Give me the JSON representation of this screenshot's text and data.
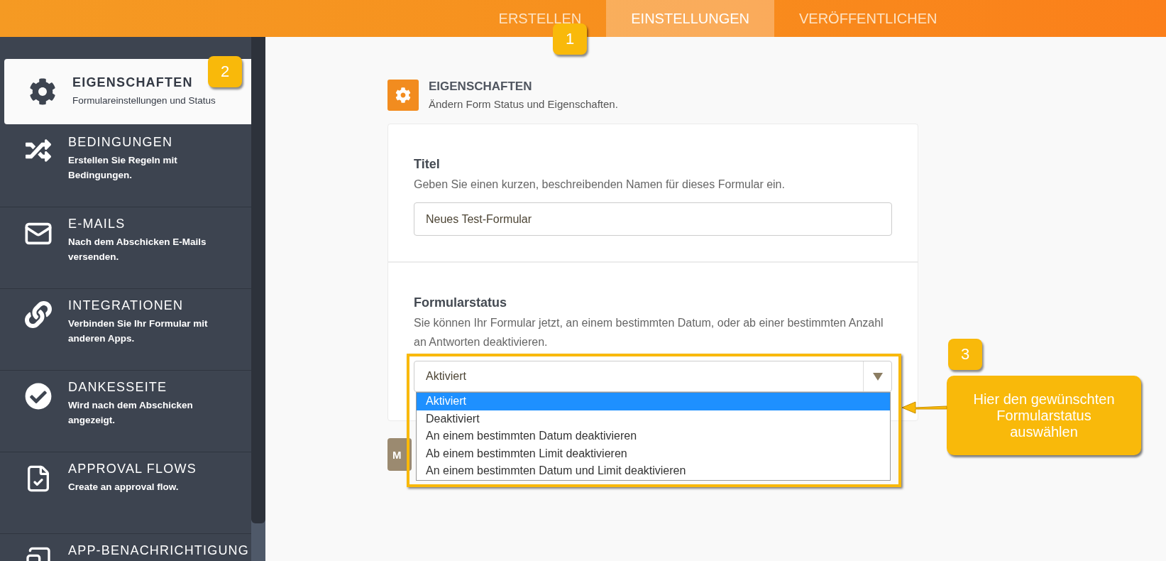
{
  "top_nav": {
    "tabs": [
      {
        "label": "ERSTELLEN",
        "selected": false
      },
      {
        "label": "EINSTELLUNGEN",
        "selected": true
      },
      {
        "label": "VERÖFFENTLICHEN",
        "selected": false
      }
    ],
    "step_badge": "1"
  },
  "sidebar": {
    "step_badge": "2",
    "items": [
      {
        "kind": "gear",
        "title": "EIGENSCHAFTEN",
        "subtitle": "Formulareinstellungen und Status",
        "selected": true
      },
      {
        "kind": "conditions",
        "title": "BEDINGUNGEN",
        "subtitle": "Erstellen Sie Regeln mit Bedingungen.",
        "selected": false
      },
      {
        "kind": "mail",
        "title": "E-MAILS",
        "subtitle": "Nach dem Abschicken E-Mails versenden.",
        "selected": false
      },
      {
        "kind": "link",
        "title": "INTEGRATIONEN",
        "subtitle": "Verbinden Sie Ihr Formular mit anderen Apps.",
        "selected": false
      },
      {
        "kind": "check",
        "title": "DANKESSEITE",
        "subtitle": "Wird nach dem Abschicken angezeigt.",
        "selected": false
      },
      {
        "kind": "approval",
        "title": "APPROVAL FLOWS",
        "subtitle": "Create an approval flow.",
        "selected": false
      },
      {
        "kind": "device",
        "title": "APP-BENACHRICHTIGUNG",
        "selected": false
      }
    ]
  },
  "panel": {
    "title": "EIGENSCHAFTEN",
    "subtitle": "Ändern Form Status und Eigenschaften.",
    "title_field": {
      "label": "Titel",
      "description": "Geben Sie einen kurzen, beschreibenden Namen für dieses Formular ein.",
      "value": "Neues Test-Formular"
    },
    "status_field": {
      "label": "Formularstatus",
      "description": "Sie können Ihr Formular jetzt, an einem bestimmten Datum, oder ab einer bestimmten Anzahl an Antworten deaktivieren.",
      "value": "Aktiviert",
      "options": [
        {
          "label": "Aktiviert",
          "selected": true
        },
        {
          "label": "Deaktiviert",
          "selected": false
        },
        {
          "label": "An einem bestimmten Datum deaktivieren",
          "selected": false
        },
        {
          "label": "Ab einem bestimmten Limit deaktivieren",
          "selected": false
        },
        {
          "label": "An einem bestimmten Datum und Limit deaktivieren",
          "selected": false
        }
      ]
    },
    "button": "M"
  },
  "callout": {
    "step_badge": "3",
    "text": "Hier den gewünschten Formularstatus auswählen"
  }
}
